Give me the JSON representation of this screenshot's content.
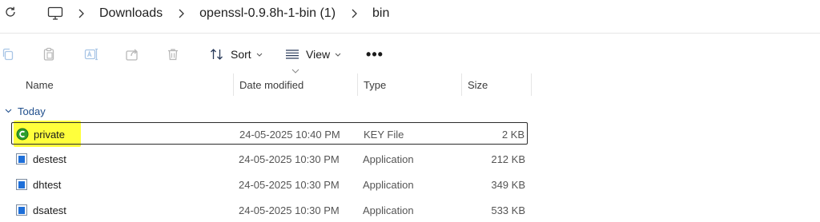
{
  "address_bar": {
    "refresh_icon": "refresh-icon",
    "computer_icon": "this-pc-icon",
    "separator_icon": "chevron-right-icon",
    "breadcrumbs": [
      "Downloads",
      "openssl-0.9.8h-1-bin (1)",
      "bin"
    ]
  },
  "command_bar": {
    "icons": [
      "copy-icon",
      "paste-icon",
      "rename-icon",
      "share-icon",
      "delete-icon"
    ],
    "sort_label": "Sort",
    "view_label": "View",
    "more_label": "•••"
  },
  "columns": {
    "name": "Name",
    "date_modified": "Date modified",
    "type": "Type",
    "size": "Size"
  },
  "group": {
    "label": "Today"
  },
  "files": [
    {
      "name": "private",
      "date": "24-05-2025 10:40 PM",
      "type": "KEY File",
      "size": "2 KB",
      "icon": "key-file-icon",
      "selected": true,
      "highlighted": true
    },
    {
      "name": "destest",
      "date": "24-05-2025 10:30 PM",
      "type": "Application",
      "size": "212 KB",
      "icon": "application-icon",
      "selected": false,
      "highlighted": false
    },
    {
      "name": "dhtest",
      "date": "24-05-2025 10:30 PM",
      "type": "Application",
      "size": "349 KB",
      "icon": "application-icon",
      "selected": false,
      "highlighted": false
    },
    {
      "name": "dsatest",
      "date": "24-05-2025 10:30 PM",
      "type": "Application",
      "size": "533 KB",
      "icon": "application-icon",
      "selected": false,
      "highlighted": false
    }
  ],
  "colors": {
    "highlight": "#ffff3c",
    "group_text": "#1f4e8c",
    "key_icon": "#2e9e2e",
    "app_icon": "#1e6fd9"
  }
}
